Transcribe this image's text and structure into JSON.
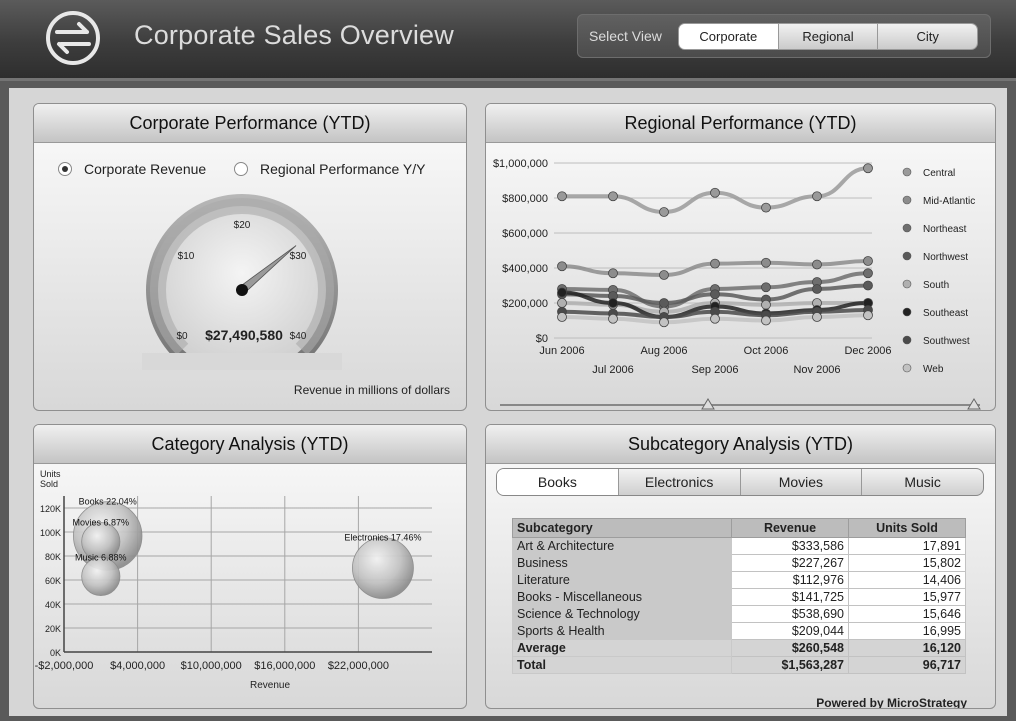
{
  "header": {
    "title": "Corporate Sales Overview",
    "select_view_label": "Select View",
    "views": [
      "Corporate",
      "Regional",
      "City"
    ],
    "active_view": "Corporate"
  },
  "corporate_panel": {
    "title": "Corporate Performance (YTD)",
    "radio_options": [
      "Corporate Revenue",
      "Regional Performance Y/Y"
    ],
    "selected_option": "Corporate Revenue",
    "gauge": {
      "value_label": "$27,490,580",
      "value_millions": 27.49,
      "min": 0,
      "max": 40,
      "tick_labels": [
        "$0",
        "$10",
        "$20",
        "$30",
        "$40"
      ],
      "caption": "Revenue in millions of dollars"
    }
  },
  "regional_panel": {
    "title": "Regional Performance (YTD)",
    "legend": [
      "Central",
      "Mid-Atlantic",
      "Northeast",
      "Northwest",
      "South",
      "Southeast",
      "Southwest",
      "Web"
    ]
  },
  "category_panel": {
    "title": "Category Analysis (YTD)"
  },
  "subcategory_panel": {
    "title": "Subcategory Analysis (YTD)",
    "tabs": [
      "Books",
      "Electronics",
      "Movies",
      "Music"
    ],
    "active_tab": "Books",
    "table": {
      "headers": [
        "Subcategory",
        "Revenue",
        "Units Sold"
      ],
      "rows": [
        [
          "Art & Architecture",
          "$333,586",
          "17,891"
        ],
        [
          "Business",
          "$227,267",
          "15,802"
        ],
        [
          "Literature",
          "$112,976",
          "14,406"
        ],
        [
          "Books - Miscellaneous",
          "$141,725",
          "15,977"
        ],
        [
          "Science & Technology",
          "$538,690",
          "15,646"
        ],
        [
          "Sports & Health",
          "$209,044",
          "16,995"
        ]
      ],
      "summary": [
        [
          "Average",
          "$260,548",
          "16,120"
        ],
        [
          "Total",
          "$1,563,287",
          "96,717"
        ]
      ]
    },
    "powered_by": "Powered by",
    "powered_link": "MicroStrategy"
  },
  "chart_data": [
    {
      "type": "line",
      "x": [
        "Jun 2006",
        "Jul 2006",
        "Aug 2006",
        "Sep 2006",
        "Oct 2006",
        "Nov 2006",
        "Dec 2006"
      ],
      "y_ticks": [
        "$0",
        "$200,000",
        "$400,000",
        "$600,000",
        "$800,000",
        "$1,000,000"
      ],
      "ylim": [
        0,
        1000000
      ],
      "legend_position": "right",
      "series": [
        {
          "name": "Central",
          "values": [
            810000,
            810000,
            720000,
            830000,
            745000,
            810000,
            970000
          ],
          "color": "#9a9a9a"
        },
        {
          "name": "Mid-Atlantic",
          "values": [
            410000,
            370000,
            360000,
            425000,
            430000,
            420000,
            440000
          ],
          "color": "#8c8c8c"
        },
        {
          "name": "Northeast",
          "values": [
            280000,
            275000,
            180000,
            280000,
            290000,
            320000,
            370000
          ],
          "color": "#6e6e6e"
        },
        {
          "name": "Northwest",
          "values": [
            250000,
            240000,
            200000,
            250000,
            220000,
            280000,
            300000
          ],
          "color": "#5a5a5a"
        },
        {
          "name": "South",
          "values": [
            200000,
            190000,
            150000,
            200000,
            190000,
            200000,
            200000
          ],
          "color": "#b0b0b0"
        },
        {
          "name": "Southeast",
          "values": [
            260000,
            200000,
            120000,
            180000,
            140000,
            160000,
            200000
          ],
          "color": "#222222"
        },
        {
          "name": "Southwest",
          "values": [
            150000,
            140000,
            120000,
            150000,
            130000,
            150000,
            160000
          ],
          "color": "#4a4a4a"
        },
        {
          "name": "Web",
          "values": [
            120000,
            110000,
            90000,
            110000,
            100000,
            120000,
            130000
          ],
          "color": "#c2c2c2"
        }
      ]
    },
    {
      "type": "scatter",
      "xlabel": "Revenue",
      "ylabel": "Units Sold",
      "x_ticks": [
        "-$2,000,000",
        "$4,000,000",
        "$10,000,000",
        "$16,000,000",
        "$22,000,000"
      ],
      "y_ticks": [
        "0K",
        "20K",
        "40K",
        "60K",
        "80K",
        "100K",
        "120K"
      ],
      "xlim": [
        -2000000,
        28000000
      ],
      "ylim": [
        0,
        130000
      ],
      "points": [
        {
          "label": "Books 22.04%",
          "x": 1563287,
          "y": 96717,
          "size": 22.04
        },
        {
          "label": "Movies 6.87%",
          "x": 1000000,
          "y": 92000,
          "size": 6.87
        },
        {
          "label": "Music 6.88%",
          "x": 1000000,
          "y": 63000,
          "size": 6.88
        },
        {
          "label": "Electronics 17.46%",
          "x": 24000000,
          "y": 70000,
          "size": 17.46
        }
      ]
    }
  ]
}
